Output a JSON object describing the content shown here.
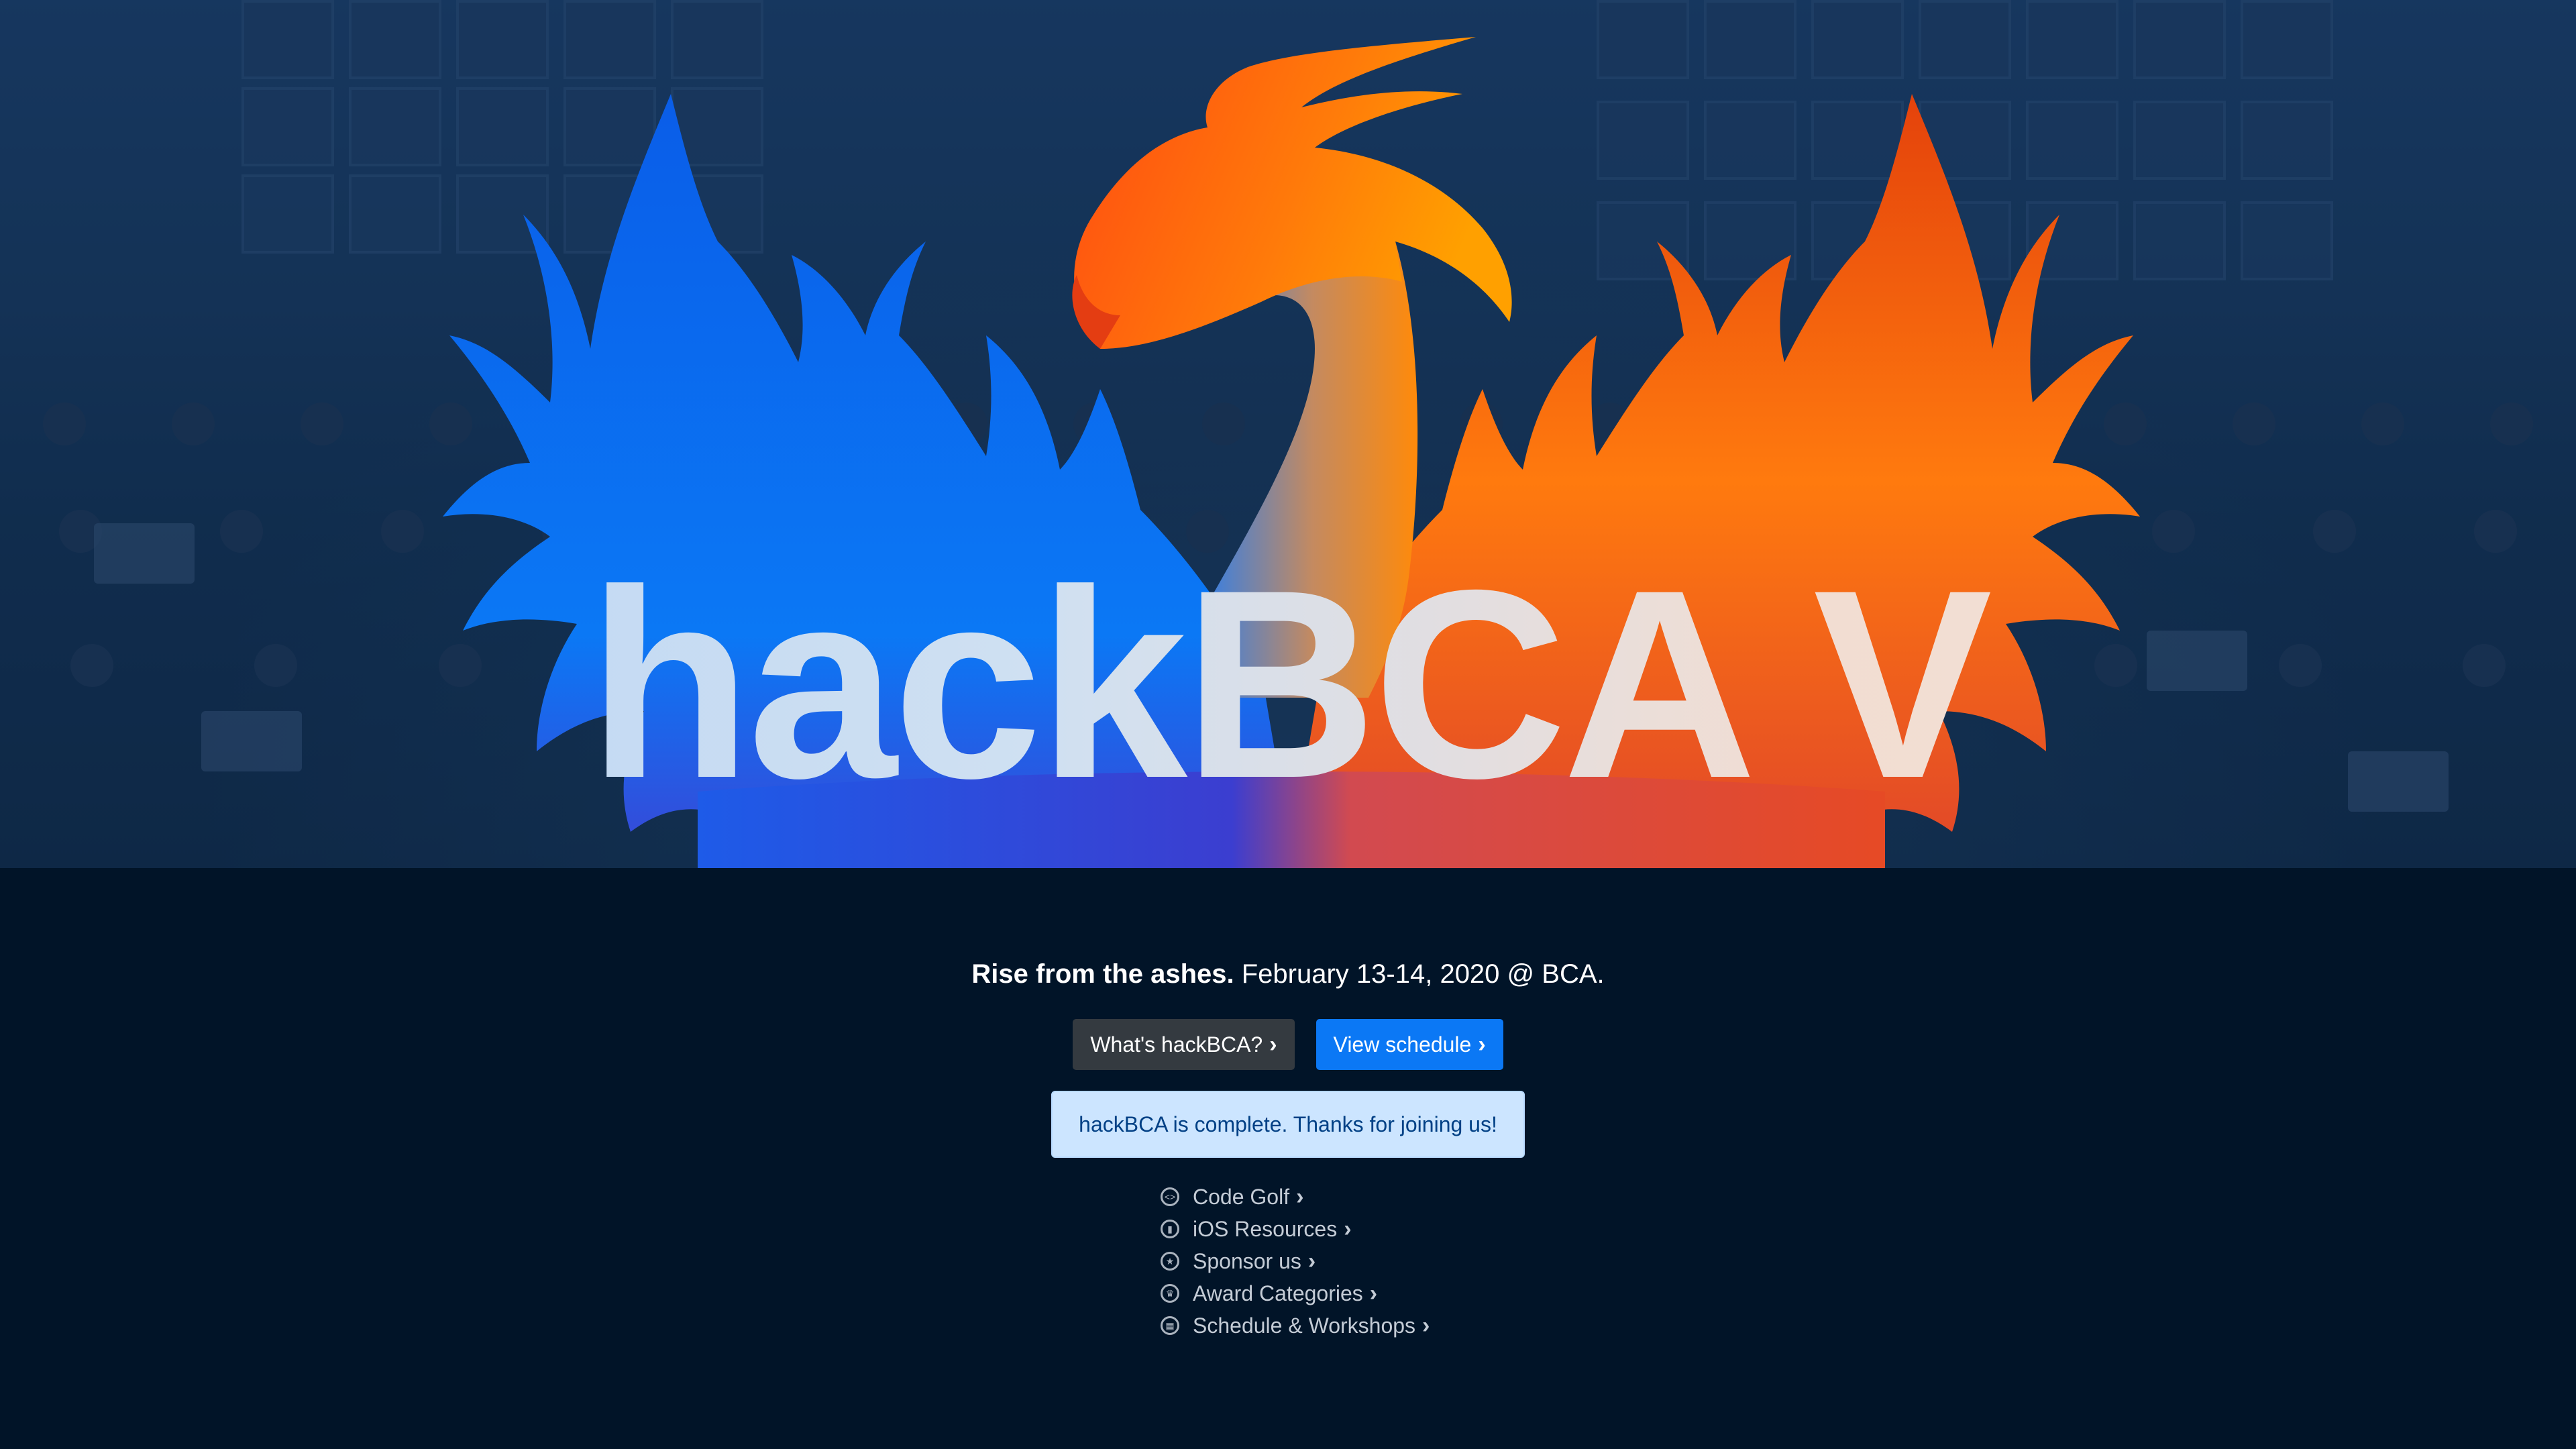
{
  "colors": {
    "page_background": "#011428",
    "hero_tint": "#12325c",
    "button_dark": "#343a40",
    "button_primary": "#0b78f5",
    "alert_background": "#cce5ff",
    "alert_text": "#004085",
    "phoenix_blue": "#0a6cf0",
    "phoenix_orange": "#ff8a0a"
  },
  "hero": {
    "title": "hackBCA V",
    "logo_icon": "phoenix-logo-icon"
  },
  "tagline": {
    "bold": "Rise from the ashes.",
    "rest": " February 13-14, 2020 @ BCA."
  },
  "buttons": {
    "about": {
      "label": "What's hackBCA?",
      "icon": "chevron-right-icon"
    },
    "schedule": {
      "label": "View schedule",
      "icon": "chevron-right-icon"
    }
  },
  "alert": {
    "text": "hackBCA is complete. Thanks for joining us!"
  },
  "links": [
    {
      "label": "Code Golf",
      "icon": "code-icon"
    },
    {
      "label": "iOS Resources",
      "icon": "mobile-icon"
    },
    {
      "label": "Sponsor us",
      "icon": "star-icon"
    },
    {
      "label": "Award Categories",
      "icon": "trophy-icon"
    },
    {
      "label": "Schedule & Workshops",
      "icon": "calendar-icon"
    }
  ]
}
